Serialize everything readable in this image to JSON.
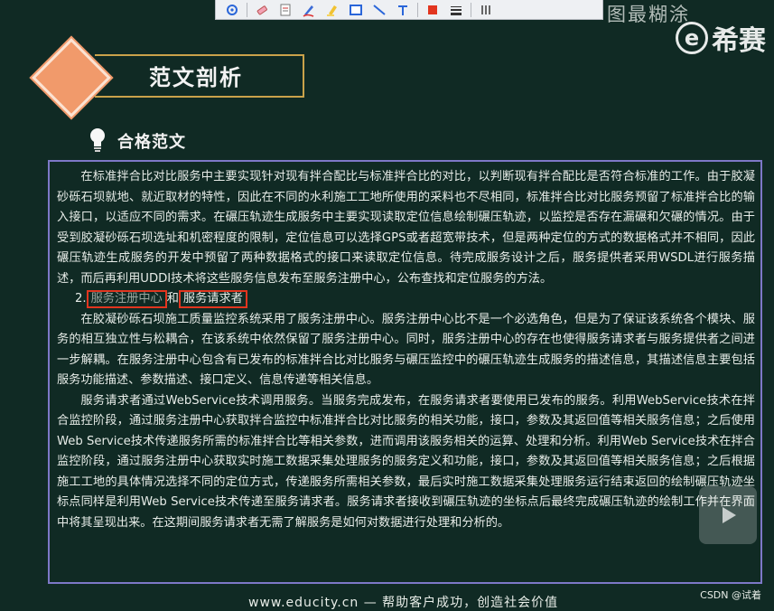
{
  "toolbar": {
    "tools": [
      "pointer-tool",
      "eraser-tool",
      "stamp-tool",
      "pen-tool",
      "highlighter-tool",
      "rectangle-tool",
      "line-tool",
      "text-tool",
      "color-red",
      "line-width",
      "more-tool"
    ],
    "accent": "#e2351f"
  },
  "overlay_text": "图最糊涂",
  "brand": {
    "logo_letter": "e",
    "name": "希赛"
  },
  "section_title": "范文剖析",
  "sub_title": "合格范文",
  "paragraphs": {
    "p1": "在标准拌合比对比服务中主要实现针对现有拌合配比与标准拌合比的对比，以判断现有拌合配比是否符合标准的工作。由于胶凝砂砾石坝就地、就近取材的特性，因此在不同的水利施工工地所使用的采料也不尽相同，标准拌合比对比服务预留了标准拌合比的输入接口，以适应不同的需求。在碾压轨迹生成服务中主要实现读取定位信息绘制碾压轨迹，以监控是否存在漏碾和欠碾的情况。由于受到胶凝砂砾石坝选址和机密程度的限制，定位信息可以选择GPS或者超宽带技术，但是两种定位的方式的数据格式并不相同，因此碾压轨迹生成服务的开发中预留了两种数据格式的接口来读取定位信息。待完成服务设计之后，服务提供者采用WSDL进行服务描述，而后再利用UDDI技术将这些服务信息发布至服务注册中心，公布查找和定位服务的方法。",
    "heading_num": "2.",
    "heading_a": "服务注册中心",
    "heading_and": "和",
    "heading_b": "服务请求者",
    "p2": "在胶凝砂砾石坝施工质量监控系统采用了服务注册中心。服务注册中心比不是一个必选角色，但是为了保证该系统各个模块、服务的相互独立性与松耦合，在该系统中依然保留了服务注册中心。同时，服务注册中心的存在也使得服务请求者与服务提供者之间进一步解耦。在服务注册中心包含有已发布的标准拌合比对比服务与碾压监控中的碾压轨迹生成服务的描述信息，其描述信息主要包括服务功能描述、参数描述、接口定义、信息传递等相关信息。",
    "p3": "服务请求者通过WebService技术调用服务。当服务完成发布，在服务请求者要使用已发布的服务。利用WebService技术在拌合监控阶段，通过服务注册中心获取拌合监控中标准拌合比对比服务的相关功能，接口，参数及其返回值等相关服务信息；之后使用Web Service技术传递服务所需的标准拌合比等相关参数，进而调用该服务相关的运算、处理和分析。利用Web Service技术在拌合监控阶段，通过服务注册中心获取实时施工数据采集处理服务的服务定义和功能，接口，参数及其返回值等相关服务信息；之后根据施工工地的具体情况选择不同的定位方式，传递服务所需相关参数，最后实时施工数据采集处理服务运行结束返回的绘制碾压轨迹坐标点同样是利用Web Service技术传递至服务请求者。服务请求者接收到碾压轨迹的坐标点后最终完成碾压轨迹的绘制工作并在界面中将其呈现出来。在这期间服务请求者无需了解服务是如何对数据进行处理和分析的。"
  },
  "footer": "www.educity.cn — 帮助客户成功，创造社会价值",
  "watermark": "CSDN @试着",
  "colors": {
    "background": "#102a24",
    "diamond": "#f19a6b",
    "title_border": "#c9a24a",
    "content_border": "#7d78c7",
    "highlight_box": "#e2351f"
  }
}
